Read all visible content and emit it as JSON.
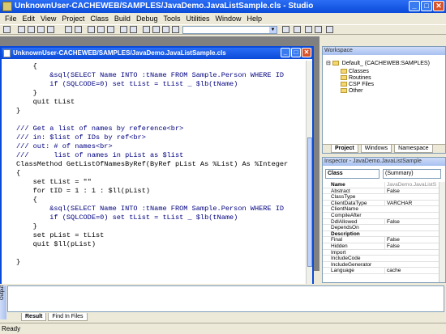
{
  "window": {
    "title": "UnknownUser-CACHEWEB/SAMPLES/JavaDemo.JavaListSample.cls - Studio"
  },
  "menu": [
    "File",
    "Edit",
    "View",
    "Project",
    "Class",
    "Build",
    "Debug",
    "Tools",
    "Utilities",
    "Window",
    "Help"
  ],
  "editor": {
    "title": "UnknownUser-CACHEWEB/SAMPLES/JavaDemo.JavaListSample.cls",
    "lines": [
      "    {",
      "        &sql(SELECT Name INTO :tName FROM Sample.Person WHERE ID",
      "        if (SQLCODE=0) set tList = tList _ $lb(tName)",
      "    }",
      "    quit tList",
      "}",
      "",
      "/// Get a list of names by reference<br>",
      "/// in: $list of IDs by ref<br>",
      "/// out: # of names<br>",
      "///      list of names in pList as $list",
      "ClassMethod GetListOfNamesByRef(ByRef pList As %List) As %Integer",
      "{",
      "    set tList = \"\"",
      "    for tID = 1 : 1 : $ll(pList)",
      "    {",
      "        &sql(SELECT Name INTO :tName FROM Sample.Person WHERE ID",
      "        if (SQLCODE=0) set tList = tList _ $lb(tName)",
      "    }",
      "    set pList = tList",
      "    quit $ll(pList)",
      "",
      "}"
    ]
  },
  "workspace": {
    "title": "Workspace",
    "root": "Default_ (CACHEWEB:SAMPLES)",
    "folders": [
      "Classes",
      "Routines",
      "CSP Files",
      "Other"
    ],
    "tabs": [
      "Project",
      "Windows",
      "Namespace"
    ]
  },
  "inspector": {
    "title": "Inspector - JavaDemo.JavaListSample",
    "category": "Class",
    "summary": "(Summary)",
    "rows": [
      {
        "name": "Name",
        "value": "JavaDemo.JavaListS",
        "bold": true
      },
      {
        "name": "Abstract",
        "value": "False",
        "bold": false
      },
      {
        "name": "ClassType",
        "value": "",
        "bold": false
      },
      {
        "name": "ClientDataType",
        "value": "VARCHAR",
        "bold": false
      },
      {
        "name": "ClientName",
        "value": "",
        "bold": false
      },
      {
        "name": "CompileAfter",
        "value": "",
        "bold": false
      },
      {
        "name": "DdlAllowed",
        "value": "False",
        "bold": false
      },
      {
        "name": "DependsOn",
        "value": "",
        "bold": false
      },
      {
        "name": "Description",
        "value": "",
        "bold": true
      },
      {
        "name": "Final",
        "value": "False",
        "bold": false
      },
      {
        "name": "Hidden",
        "value": "False",
        "bold": false
      },
      {
        "name": "Import",
        "value": "",
        "bold": false
      },
      {
        "name": "IncludeCode",
        "value": "",
        "bold": false
      },
      {
        "name": "IncludeGenerator",
        "value": "",
        "bold": false
      },
      {
        "name": "Language",
        "value": "cache",
        "bold": false
      }
    ]
  },
  "output": {
    "tabs": [
      "Result",
      "Find In Files"
    ],
    "side_label": "Output"
  },
  "status": {
    "text": "Ready"
  }
}
